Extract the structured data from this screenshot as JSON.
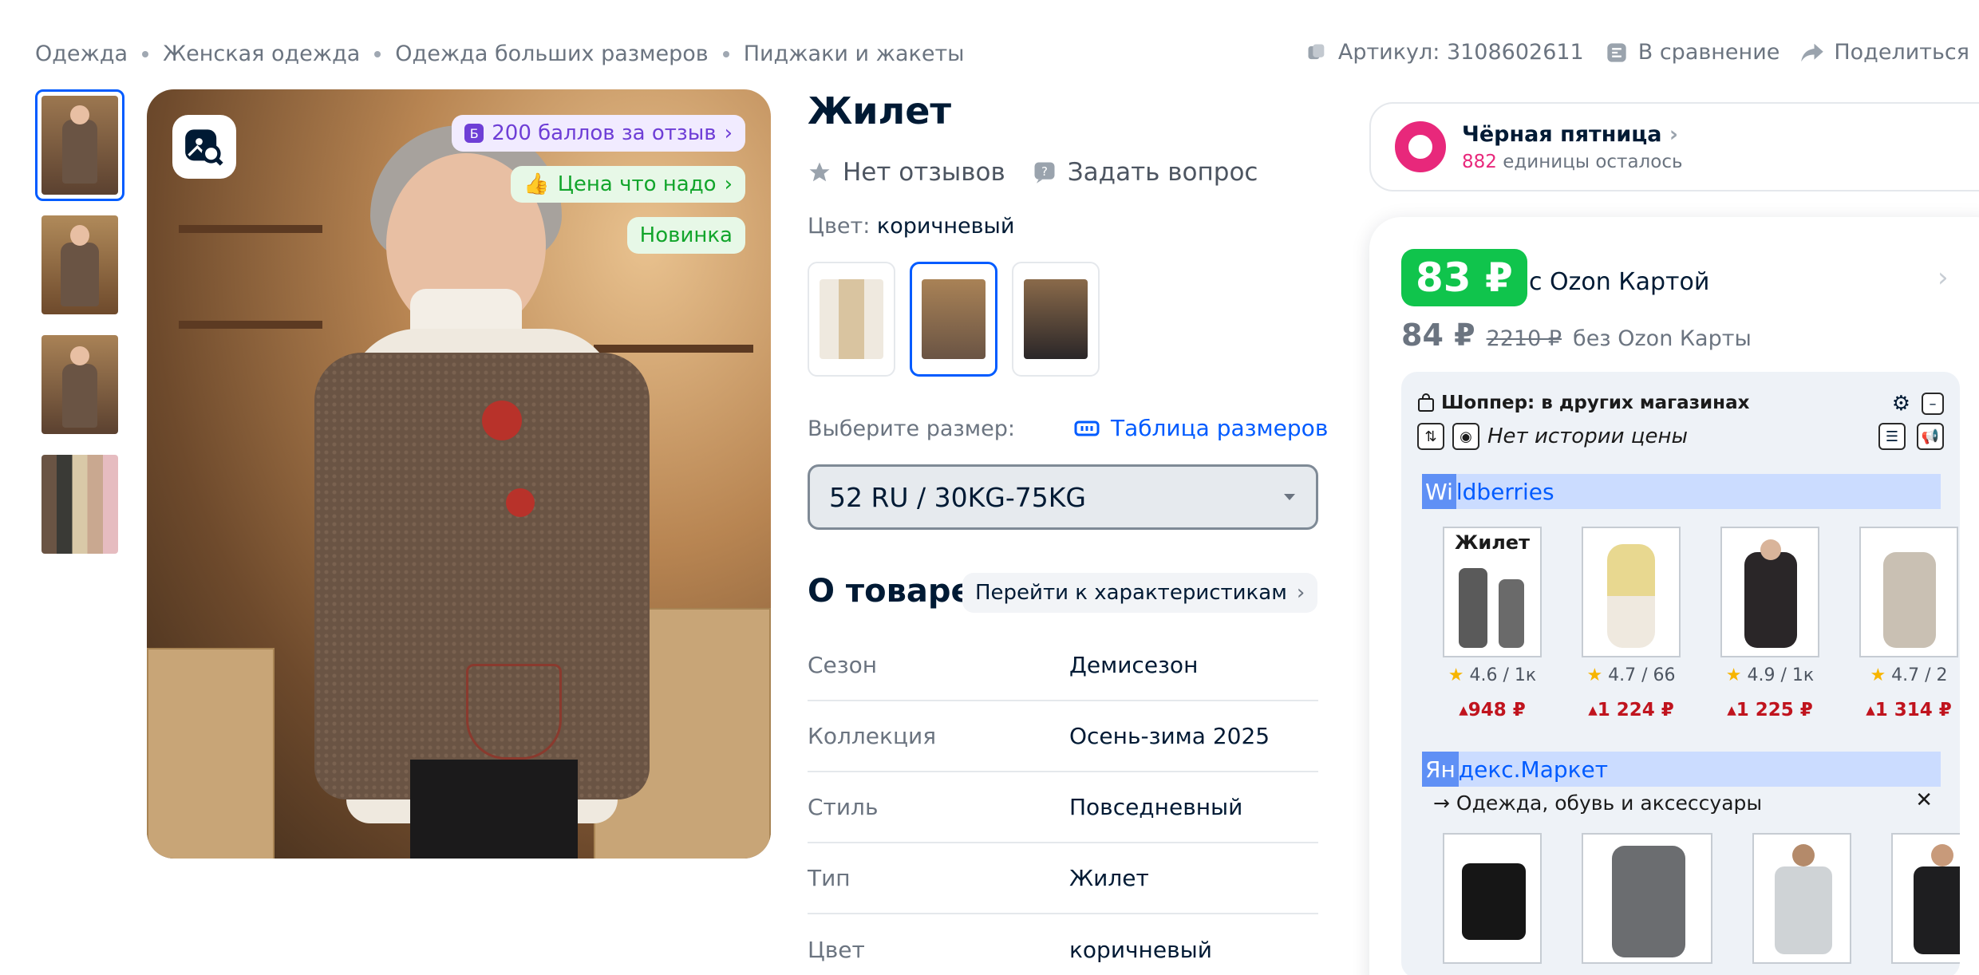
{
  "breadcrumb": [
    "Одежда",
    "Женская одежда",
    "Одежда больших размеров",
    "Пиджаки и жакеты"
  ],
  "top_actions": {
    "article": "Артикул: 3108602611",
    "compare": "В сравнение",
    "share": "Поделиться"
  },
  "gallery": {
    "badges": {
      "points": "200 баллов за отзыв",
      "price": "Цена что надо",
      "new": "Новинка"
    }
  },
  "product": {
    "title": "Жилет",
    "no_reviews": "Нет отзывов",
    "ask_question": "Задать вопрос",
    "color_label": "Цвет:",
    "color_value": "коричневый",
    "size_label": "Выберите размер:",
    "size_table": "Таблица размеров",
    "size_selected": "52 RU / 30KG-75KG"
  },
  "about": {
    "title": "О товаре",
    "link": "Перейти к характеристикам",
    "props": [
      {
        "k": "Сезон",
        "v": "Демисезон"
      },
      {
        "k": "Коллекция",
        "v": "Осень-зима 2025"
      },
      {
        "k": "Стиль",
        "v": "Повседневный"
      },
      {
        "k": "Тип",
        "v": "Жилет"
      },
      {
        "k": "Цвет",
        "v": "коричневый"
      }
    ]
  },
  "promo": {
    "title": "Чёрная пятница",
    "count": "882",
    "remaining": "единицы осталось"
  },
  "price": {
    "ozon_price": "83 ₽",
    "ozon_label": "с Ozon Картой",
    "regular": "84 ₽",
    "old": "2210 ₽",
    "no_card_label": "без Ozon Карты"
  },
  "shopper": {
    "title_bold": "Шоппер:",
    "title_rest": "в других магазинах",
    "no_history": "Нет истории цены",
    "wb_prefix": "Wi",
    "wb_rest": "ldberries",
    "wb_products": [
      {
        "rating": "4.6 / 1к",
        "price": "▴948 ₽"
      },
      {
        "rating": "4.7 / 66",
        "price": "▴1 224 ₽"
      },
      {
        "rating": "4.9 / 1к",
        "price": "▴1 225 ₽"
      },
      {
        "rating": "4.7 / 2",
        "price": "▴1 314 ₽"
      }
    ],
    "wb_first_label": "Жилет",
    "ym_prefix": "Ян",
    "ym_rest": "декс.Маркет",
    "ym_category": "→ Одежда, обувь и аксессуары",
    "ym_close": "✕"
  },
  "colors": {
    "accent": "#005bff",
    "green": "#10c44c",
    "pink": "#e8287b",
    "red_price": "#c0141e"
  }
}
